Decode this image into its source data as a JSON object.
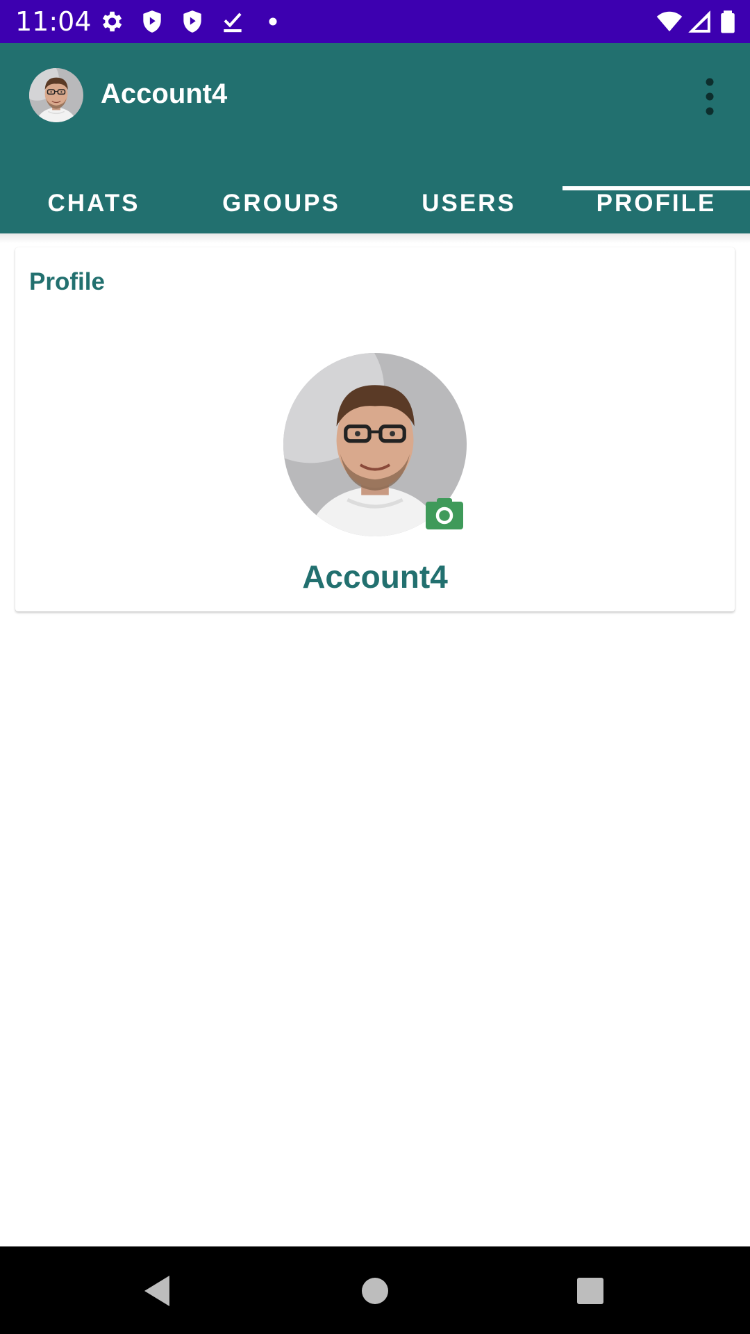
{
  "status_bar": {
    "time": "11:04",
    "icons": [
      "gear-icon",
      "shield-icon",
      "shield-icon",
      "download-done-icon",
      "dot-icon",
      "wifi-icon",
      "signal-icon",
      "battery-icon"
    ]
  },
  "app_bar": {
    "title": "Account4",
    "avatar_icon": "avatar",
    "menu_icon": "more-vert-icon"
  },
  "tabs": [
    {
      "label": "CHATS",
      "selected": false
    },
    {
      "label": "GROUPS",
      "selected": false
    },
    {
      "label": "USERS",
      "selected": false
    },
    {
      "label": "PROFILE",
      "selected": true
    }
  ],
  "profile_card": {
    "title": "Profile",
    "name": "Account4",
    "camera_icon": "camera-icon"
  },
  "nav_bar": {
    "icons": [
      "back-icon",
      "home-icon",
      "recents-icon"
    ]
  },
  "colors": {
    "status_bar": "#3d00b0",
    "app_bar": "#22706f",
    "accent_text": "#22706f",
    "camera_badge": "#3f9a5a"
  }
}
